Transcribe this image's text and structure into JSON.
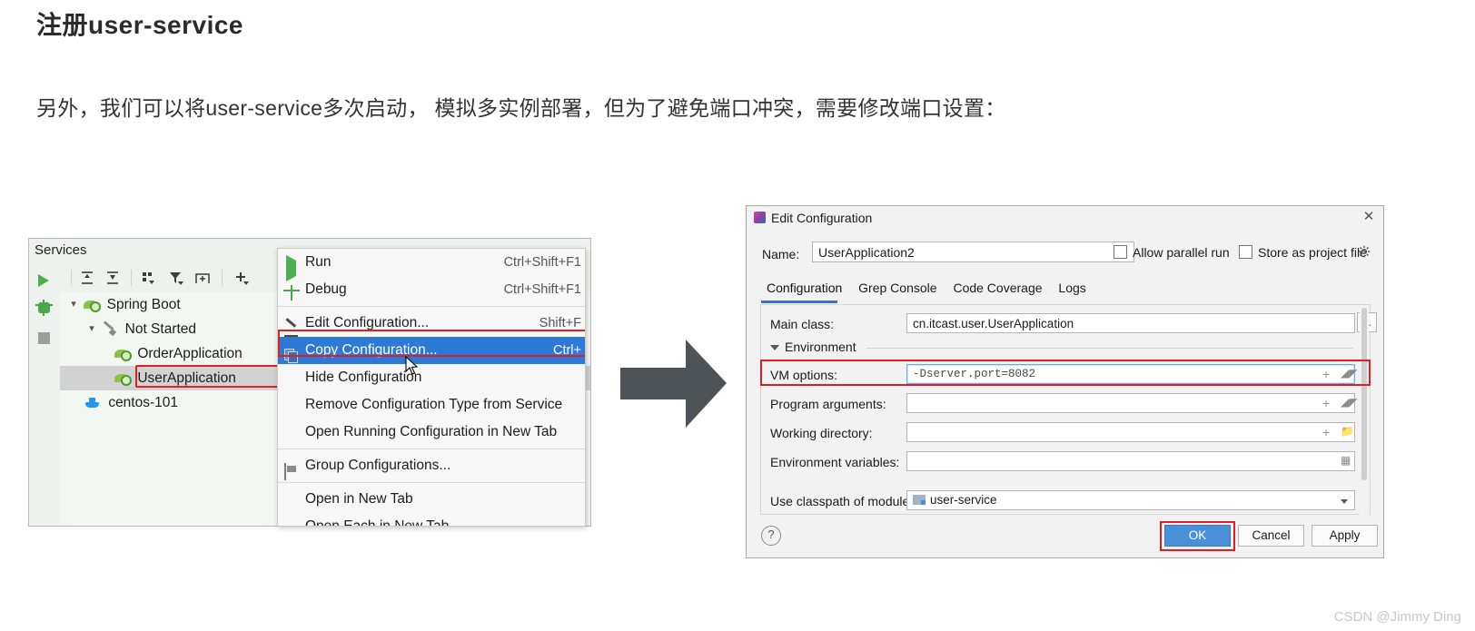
{
  "article": {
    "title": "注册user-service",
    "paragraph": "另外，我们可以将user-service多次启动， 模拟多实例部署，但为了避免端口冲突，需要修改端口设置："
  },
  "services_panel": {
    "title": "Services",
    "gutter_icons": [
      "run-icon",
      "debug-icon",
      "stop-icon"
    ],
    "toolbar_icons": [
      "expand-all-icon",
      "collapse-all-icon",
      "group-by-icon",
      "filter-icon",
      "add-tab-icon",
      "add-icon"
    ],
    "tree": [
      {
        "label": "Spring Boot",
        "icon": "spring-boot-icon",
        "depth": 0,
        "expanded": true,
        "selected": false
      },
      {
        "label": "Not Started",
        "icon": "wrench-icon",
        "depth": 1,
        "expanded": true,
        "selected": false
      },
      {
        "label": "OrderApplication",
        "icon": "spring-boot-icon",
        "depth": 2,
        "expanded": null,
        "selected": false
      },
      {
        "label": "UserApplication",
        "icon": "spring-boot-icon",
        "depth": 2,
        "expanded": null,
        "selected": true
      },
      {
        "label": "centos-101",
        "icon": "docker-icon",
        "depth": 1,
        "expanded": null,
        "selected": false
      }
    ]
  },
  "context_menu": {
    "items": [
      {
        "label": "Run",
        "shortcut": "Ctrl+Shift+F1",
        "icon": "run-icon",
        "highlight": false
      },
      {
        "label": "Debug",
        "shortcut": "Ctrl+Shift+F1",
        "icon": "debug-icon",
        "highlight": false
      },
      {
        "label": "Edit Configuration...",
        "shortcut": "Shift+F",
        "icon": "pencil-icon",
        "highlight": false
      },
      {
        "label": "Copy Configuration...",
        "shortcut": "Ctrl+",
        "icon": "copy-icon",
        "highlight": true
      },
      {
        "label": "Hide Configuration",
        "shortcut": "",
        "icon": "",
        "highlight": false
      },
      {
        "label": "Remove Configuration Type from Service",
        "shortcut": "",
        "icon": "",
        "highlight": false
      },
      {
        "label": "Open Running Configuration in New Tab",
        "shortcut": "",
        "icon": "",
        "highlight": false
      },
      {
        "label": "Group Configurations...",
        "shortcut": "",
        "icon": "folder-icon",
        "highlight": false
      },
      {
        "label": "Open in New Tab",
        "shortcut": "",
        "icon": "",
        "highlight": false
      },
      {
        "label": "Open Each in New Tab",
        "shortcut": "",
        "icon": "",
        "highlight": false
      }
    ]
  },
  "dialog": {
    "title": "Edit Configuration",
    "close_label": "✕",
    "name_label": "Name:",
    "name_value": "UserApplication2",
    "allow_parallel_run": "Allow parallel run",
    "store_as_project_file": "Store as project file",
    "tabs": [
      "Configuration",
      "Grep Console",
      "Code Coverage",
      "Logs"
    ],
    "active_tab": "Configuration",
    "fields": [
      {
        "label": "Main class:",
        "value": "cn.itcast.user.UserApplication",
        "mono": false,
        "focus": false
      },
      {
        "label": "VM options:",
        "value": "-Dserver.port=8082",
        "mono": true,
        "focus": true
      },
      {
        "label": "Program arguments:",
        "value": "",
        "mono": false,
        "focus": false
      },
      {
        "label": "Working directory:",
        "value": "",
        "mono": false,
        "focus": false
      },
      {
        "label": "Environment variables:",
        "value": "",
        "mono": false,
        "focus": false
      }
    ],
    "environment_section": "Environment",
    "module_label": "Use classpath of module:",
    "module_value": "user-service",
    "browse_label": "...",
    "help_label": "?",
    "buttons": {
      "ok": "OK",
      "cancel": "Cancel",
      "apply": "Apply"
    }
  },
  "colors": {
    "accent_blue": "#4a90d9",
    "highlight_blue": "#2c7ad6",
    "annotation_red": "#e02020",
    "spring_green": "#4caf50",
    "arrow_grey": "#4d5357"
  },
  "watermark": "CSDN @Jimmy Ding"
}
